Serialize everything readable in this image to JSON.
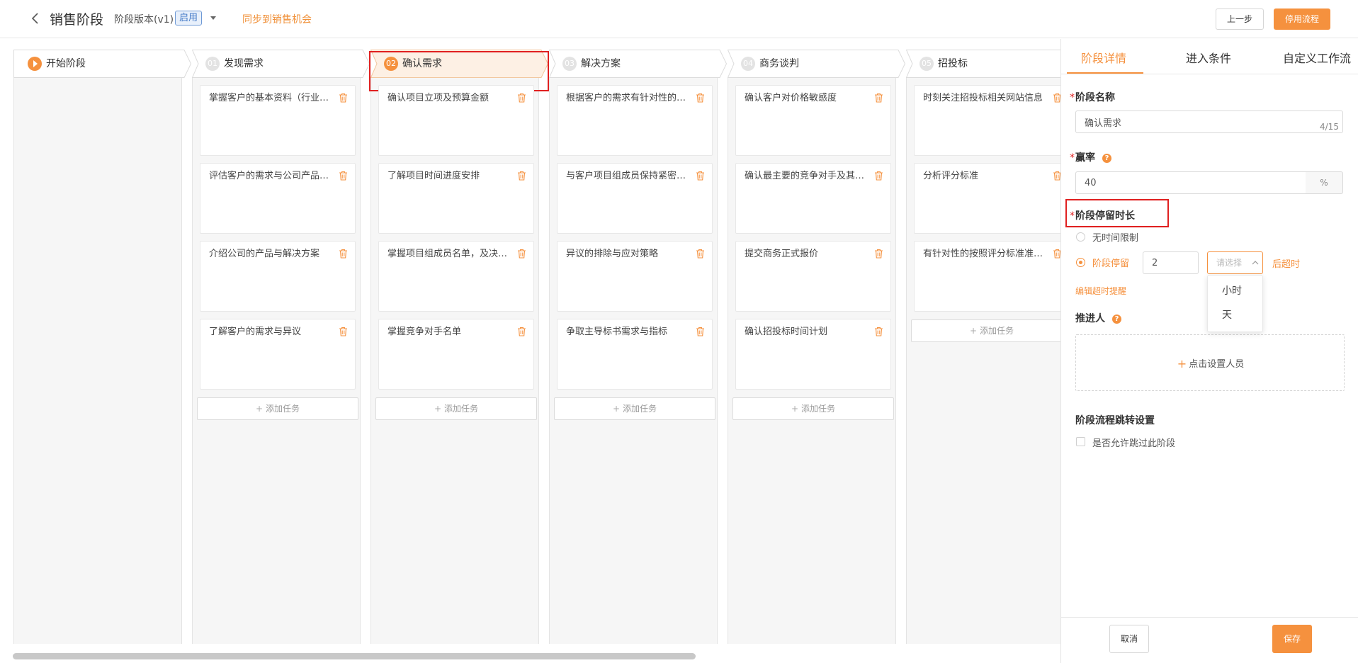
{
  "header": {
    "title": "销售阶段",
    "version_label": "阶段版本(v1)",
    "version_status": "启用",
    "sync_link": "同步到销售机会",
    "prev_button": "上一步",
    "stop_button": "停用流程"
  },
  "stages": [
    {
      "num": "",
      "label": "开始阶段",
      "active": false,
      "icon": "play-icon"
    },
    {
      "num": "01",
      "label": "发现需求",
      "active": false
    },
    {
      "num": "02",
      "label": "确认需求",
      "active": true
    },
    {
      "num": "03",
      "label": "解决方案",
      "active": false
    },
    {
      "num": "04",
      "label": "商务谈判",
      "active": false
    },
    {
      "num": "05",
      "label": "招投标",
      "active": false
    }
  ],
  "columns": [
    {
      "stage": "发现需求",
      "tasks": [
        "掌握客户的基本资料（行业、规模、组织架构等）",
        "评估客户的需求与公司产品的匹配度",
        "介绍公司的产品与解决方案",
        "了解客户的需求与异议"
      ]
    },
    {
      "stage": "确认需求",
      "tasks": [
        "确认项目立项及预算金额",
        "了解项目时间进度安排",
        "掌握项目组成员名单，及决策链",
        "掌握竞争对手名单"
      ]
    },
    {
      "stage": "解决方案",
      "tasks": [
        "根据客户的需求有针对性的提供解决方案",
        "与客户项目组成员保持紧密联系",
        "异议的排除与应对策略",
        "争取主导标书需求与指标"
      ]
    },
    {
      "stage": "商务谈判",
      "tasks": [
        "确认客户对价格敏感度",
        "确认最主要的竞争对手及其报价",
        "提交商务正式报价",
        "确认招投标时间计划"
      ]
    },
    {
      "stage": "招投标",
      "tasks": [
        "时刻关注招投标相关网站信息",
        "分析评分标准",
        "有针对性的按照评分标准准备标书"
      ]
    }
  ],
  "add_task_label": "添加任务",
  "panel": {
    "tabs": [
      "阶段详情",
      "进入条件",
      "自定义工作流"
    ],
    "active_tab": "阶段详情",
    "stage_name": {
      "label": "阶段名称",
      "value": "确认需求",
      "count": "4/15"
    },
    "win_rate": {
      "label": "赢率",
      "value": "40",
      "unit": "%"
    },
    "dwell": {
      "label": "阶段停留时长",
      "option_unlimited": "无时间限制",
      "option_stay": "阶段停留",
      "stay_value": "2",
      "unit_placeholder": "请选择",
      "timeout_suffix": "后超时",
      "edit_reminder": "编辑超时提醒",
      "unit_options": [
        "小时",
        "天"
      ]
    },
    "assignee": {
      "label": "推进人",
      "set_label": "点击设置人员"
    },
    "jump": {
      "title": "阶段流程跳转设置",
      "checkbox_label": "是否允许跳过此阶段"
    },
    "cancel_button": "取消",
    "save_button": "保存"
  },
  "colors": {
    "accent": "#f5913e",
    "highlight_border": "#e02020",
    "active_stage_bg": "#fdf0e4",
    "column_bg": "#f6f6f6",
    "version_badge": "#3e76c5"
  }
}
